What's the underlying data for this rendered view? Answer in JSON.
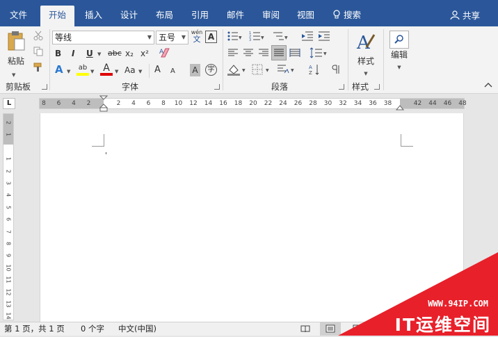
{
  "tabs": {
    "file": "文件",
    "home": "开始",
    "insert": "插入",
    "design": "设计",
    "layout": "布局",
    "references": "引用",
    "mailings": "邮件",
    "review": "审阅",
    "view": "视图",
    "search": "搜索",
    "share": "共享"
  },
  "clipboard": {
    "paste": "粘贴",
    "label": "剪贴板"
  },
  "font": {
    "name": "等线",
    "size": "五号",
    "wen": "wén",
    "wen_char": "文",
    "A_box": "A",
    "bold": "B",
    "italic": "I",
    "underline": "U",
    "strike": "abc",
    "subscript": "x₂",
    "superscript": "x²",
    "case": "Aa",
    "label": "字体",
    "grow": "A",
    "shrink": "A",
    "char_shade": "A",
    "enclose": "字",
    "effects": "A",
    "color_a": "A",
    "highlight": "ab"
  },
  "paragraph": {
    "label": "段落"
  },
  "styles": {
    "button": "样式",
    "label": "样式"
  },
  "editing": {
    "button": "编辑"
  },
  "ruler": {
    "h_ticks": [
      "8",
      "6",
      "4",
      "2",
      "",
      "2",
      "4",
      "6",
      "8",
      "10",
      "12",
      "14",
      "16",
      "18",
      "20",
      "22",
      "24",
      "26",
      "28",
      "30",
      "32",
      "34",
      "36",
      "38",
      "",
      "42",
      "44",
      "46",
      "48"
    ],
    "v_ticks": [
      "2",
      "1",
      "",
      "1",
      "2",
      "3",
      "4",
      "5",
      "6",
      "7",
      "8",
      "9",
      "10",
      "11",
      "12",
      "13",
      "14"
    ],
    "corner": "L"
  },
  "status": {
    "pages": "第 1 页，共 1 页",
    "words": "0 个字",
    "language": "中文(中国)"
  },
  "watermark": {
    "url": "WWW.94IP.COM",
    "brand": "IT运维空间"
  }
}
